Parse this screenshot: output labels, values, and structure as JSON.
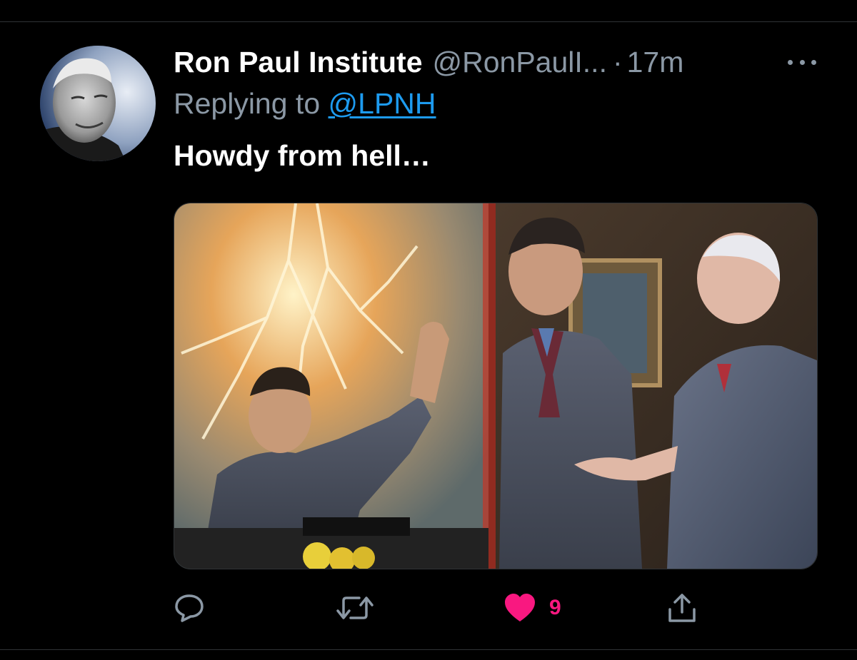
{
  "tweet": {
    "display_name": "Ron Paul Institute",
    "handle": "@RonPaulI...",
    "separator": "·",
    "time": "17m",
    "replying_prefix": "Replying to",
    "replying_to": "@LPNH",
    "text": "Howdy from hell…"
  },
  "actions": {
    "like_count": "9",
    "like_color": "#f91880"
  },
  "colors": {
    "background": "#000000",
    "secondary_text": "#8b98a5",
    "link": "#1d9bf0"
  }
}
